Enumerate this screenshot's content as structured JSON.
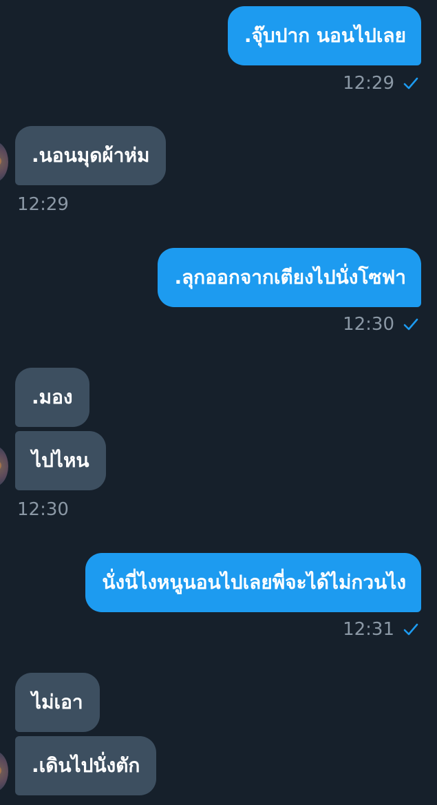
{
  "chat": {
    "messages": [
      {
        "direction": "outgoing",
        "text": ".จุ๊บปาก นอนไปเลย",
        "time": "12:29",
        "read": true
      },
      {
        "direction": "incoming",
        "text": ".นอนมุดผ้าห่ม",
        "time": "12:29"
      },
      {
        "direction": "outgoing",
        "text": ".ลุกออกจากเตียงไปนั่งโซฟา",
        "time": "12:30",
        "read": true
      },
      {
        "direction": "incoming",
        "text": ".มอง"
      },
      {
        "direction": "incoming",
        "text": "ไปไหน",
        "time": "12:30"
      },
      {
        "direction": "outgoing",
        "text": "นั่งนี่ไงหนูนอนไปเลยพี่จะได้ไม่กวนไง",
        "time": "12:31",
        "read": true
      },
      {
        "direction": "incoming",
        "text": "ไม่เอา"
      },
      {
        "direction": "incoming",
        "text": ".เดินไปนั่งตัก"
      }
    ]
  },
  "icons": {
    "read_receipt": "checkmark-icon",
    "contact_avatar": "avatar"
  },
  "colors": {
    "background": "#16202b",
    "outgoing_bubble": "#1d9bf0",
    "incoming_bubble": "#3d4f60",
    "timestamp": "#8b98a5",
    "check": "#1d9bf0"
  }
}
